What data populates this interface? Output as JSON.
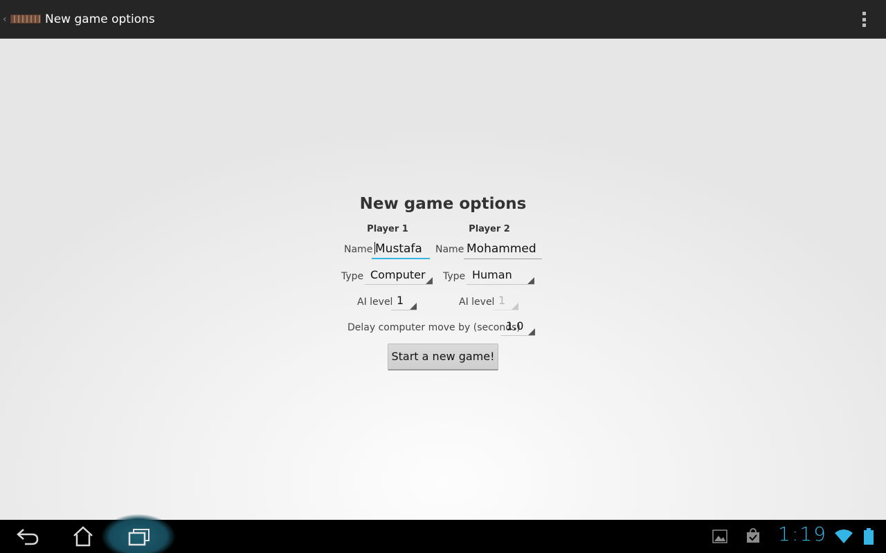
{
  "action_bar": {
    "title": "New game options",
    "up_caret": "‹"
  },
  "form": {
    "title": "New game options",
    "player1": {
      "header": "Player 1",
      "name_label": "Name",
      "name_value": "Mustafa",
      "type_label": "Type",
      "type_value": "Computer",
      "ai_label": "AI level",
      "ai_value": "1"
    },
    "player2": {
      "header": "Player 2",
      "name_label": "Name",
      "name_value": "Mohammed",
      "type_label": "Type",
      "type_value": "Human",
      "ai_label": "AI level",
      "ai_value": "1"
    },
    "delay_label": "Delay computer move by (seconds)",
    "delay_value": "1.0",
    "start_button": "Start a new game!"
  },
  "system_bar": {
    "clock": "1:19",
    "accent_color": "#33b5e5",
    "icons": [
      "back-icon",
      "home-icon",
      "recent-apps-icon",
      "gallery-notification-icon",
      "shopping-bag-notification-icon",
      "wifi-icon",
      "battery-icon"
    ]
  }
}
